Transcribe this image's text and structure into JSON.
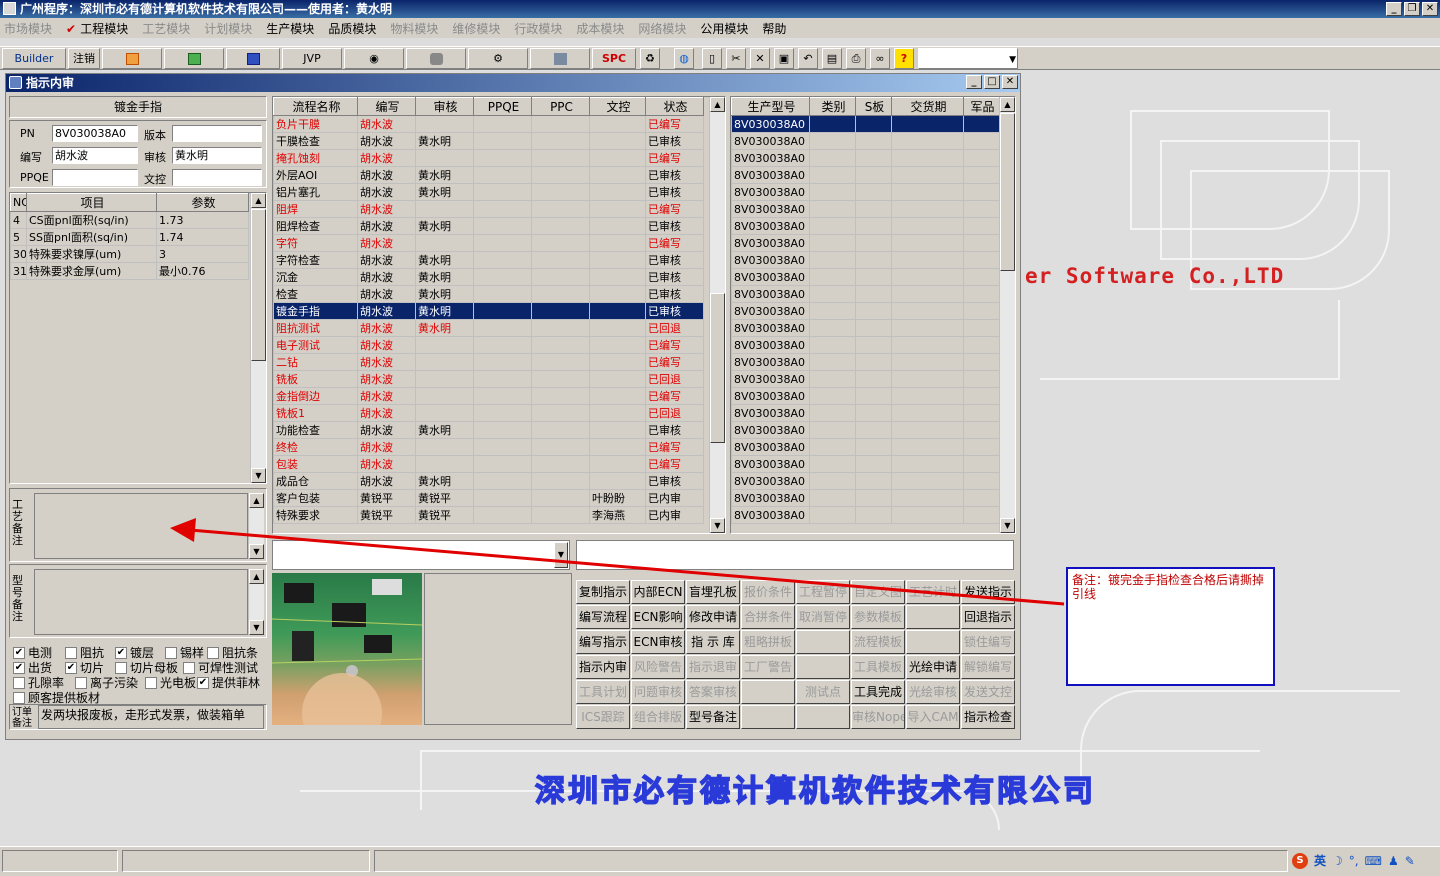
{
  "app": {
    "title": "广州程序：深圳市必有德计算机软件技术有限公司——使用者：黄水明"
  },
  "menu": [
    {
      "label": "市场模块",
      "disabled": true
    },
    {
      "label": "工程模块",
      "disabled": false,
      "checked": true
    },
    {
      "label": "工艺模块",
      "disabled": true
    },
    {
      "label": "计划模块",
      "disabled": true
    },
    {
      "label": "生产模块",
      "disabled": false
    },
    {
      "label": "品质模块",
      "disabled": false
    },
    {
      "label": "物料模块",
      "disabled": true
    },
    {
      "label": "维修模块",
      "disabled": true
    },
    {
      "label": "行政模块",
      "disabled": true
    },
    {
      "label": "成本模块",
      "disabled": true
    },
    {
      "label": "网络模块",
      "disabled": true
    },
    {
      "label": "公用模块",
      "disabled": false
    },
    {
      "label": "帮助",
      "disabled": false
    }
  ],
  "toolbar": {
    "builder": "Builder",
    "logout": "注销",
    "jvp": "JVP",
    "spc": "SPC",
    "help": "?"
  },
  "background": {
    "company_en": "er Software Co.,LTD",
    "company_cn": "深圳市必有德计算机软件技术有限公司"
  },
  "window": {
    "title": "指示内审"
  },
  "header": {
    "name": "镀金手指",
    "pn_label": "PN",
    "pn": "8V030038A0",
    "version_label": "版本",
    "version": "",
    "editor_label": "编写",
    "editor": "胡水波",
    "reviewer_label": "审核",
    "reviewer": "黄水明",
    "ppqe_label": "PPQE",
    "ppqe": "",
    "doc_label": "文控",
    "doc": ""
  },
  "params": {
    "columns": [
      "NO",
      "项目",
      "参数"
    ],
    "rows": [
      [
        "4",
        "CS面pnl面积(sq/in)",
        "1.73"
      ],
      [
        "5",
        "SS面pnl面积(sq/in)",
        "1.74"
      ],
      [
        "30",
        "特殊要求镍厚(um)",
        "3"
      ],
      [
        "31",
        "特殊要求金厚(um)",
        "最小0.76"
      ]
    ]
  },
  "process": {
    "columns": [
      "流程名称",
      "编写",
      "审核",
      "PPQE",
      "PPC",
      "文控",
      "状态"
    ],
    "rows": [
      {
        "c": [
          "负片干膜",
          "胡水波",
          "",
          "",
          "",
          "",
          "已编写"
        ],
        "red": true
      },
      {
        "c": [
          "干膜检查",
          "胡水波",
          "黄水明",
          "",
          "",
          "",
          "已审核"
        ],
        "red": false
      },
      {
        "c": [
          "掩孔蚀刻",
          "胡水波",
          "",
          "",
          "",
          "",
          "已编写"
        ],
        "red": true
      },
      {
        "c": [
          "外层AOI",
          "胡水波",
          "黄水明",
          "",
          "",
          "",
          "已审核"
        ],
        "red": false
      },
      {
        "c": [
          "铝片塞孔",
          "胡水波",
          "黄水明",
          "",
          "",
          "",
          "已审核"
        ],
        "red": false
      },
      {
        "c": [
          "阻焊",
          "胡水波",
          "",
          "",
          "",
          "",
          "已编写"
        ],
        "red": true
      },
      {
        "c": [
          "阻焊检查",
          "胡水波",
          "黄水明",
          "",
          "",
          "",
          "已审核"
        ],
        "red": false
      },
      {
        "c": [
          "字符",
          "胡水波",
          "",
          "",
          "",
          "",
          "已编写"
        ],
        "red": true
      },
      {
        "c": [
          "字符检查",
          "胡水波",
          "黄水明",
          "",
          "",
          "",
          "已审核"
        ],
        "red": false
      },
      {
        "c": [
          "沉金",
          "胡水波",
          "黄水明",
          "",
          "",
          "",
          "已审核"
        ],
        "red": false
      },
      {
        "c": [
          "检查",
          "胡水波",
          "黄水明",
          "",
          "",
          "",
          "已审核"
        ],
        "red": false
      },
      {
        "c": [
          "镀金手指",
          "胡水波",
          "黄水明",
          "",
          "",
          "",
          "已审核"
        ],
        "red": false,
        "selected": true
      },
      {
        "c": [
          "阻抗测试",
          "胡水波",
          "黄水明",
          "",
          "",
          "",
          "已回退"
        ],
        "red": true
      },
      {
        "c": [
          "电子测试",
          "胡水波",
          "",
          "",
          "",
          "",
          "已编写"
        ],
        "red": true
      },
      {
        "c": [
          "二钻",
          "胡水波",
          "",
          "",
          "",
          "",
          "已编写"
        ],
        "red": true
      },
      {
        "c": [
          "铣板",
          "胡水波",
          "",
          "",
          "",
          "",
          "已回退"
        ],
        "red": true
      },
      {
        "c": [
          "金指倒边",
          "胡水波",
          "",
          "",
          "",
          "",
          "已编写"
        ],
        "red": true
      },
      {
        "c": [
          "铣板1",
          "胡水波",
          "",
          "",
          "",
          "",
          "已回退"
        ],
        "red": true
      },
      {
        "c": [
          "功能检查",
          "胡水波",
          "黄水明",
          "",
          "",
          "",
          "已审核"
        ],
        "red": false
      },
      {
        "c": [
          "终检",
          "胡水波",
          "",
          "",
          "",
          "",
          "已编写"
        ],
        "red": true
      },
      {
        "c": [
          "包装",
          "胡水波",
          "",
          "",
          "",
          "",
          "已编写"
        ],
        "red": true
      },
      {
        "c": [
          "成品仓",
          "胡水波",
          "黄水明",
          "",
          "",
          "",
          "已审核"
        ],
        "red": false
      },
      {
        "c": [
          "客户包装",
          "黄锐平",
          "黄锐平",
          "",
          "",
          "叶盼盼",
          "已内审"
        ],
        "red": false
      },
      {
        "c": [
          "特殊要求",
          "黄锐平",
          "黄锐平",
          "",
          "",
          "李海燕",
          "已内审"
        ],
        "red": false
      }
    ]
  },
  "models": {
    "columns": [
      "生产型号",
      "类别",
      "S板",
      "交货期",
      "军品"
    ],
    "value": "8V030038A0",
    "count": 24
  },
  "side_labels": {
    "craft_note": "工艺备注",
    "model_note": "型号备注",
    "order_note": "订单备注"
  },
  "checkboxes": [
    {
      "label": "电测",
      "checked": true
    },
    {
      "label": "阻抗",
      "checked": false
    },
    {
      "label": "镀层",
      "checked": true
    },
    {
      "label": "锡样",
      "checked": false
    },
    {
      "label": "阻抗条",
      "checked": false
    },
    {
      "label": "出货",
      "checked": true
    },
    {
      "label": "切片",
      "checked": true
    },
    {
      "label": "切片母板",
      "checked": false
    },
    {
      "label": "可焊性测试",
      "checked": false
    },
    {
      "label": "孔隙率",
      "checked": false
    },
    {
      "label": "离子污染",
      "checked": false
    },
    {
      "label": "光电板",
      "checked": false
    },
    {
      "label": "提供菲林",
      "checked": true
    },
    {
      "label": "顾客提供板材",
      "checked": false
    }
  ],
  "order_note": "发两块报废板，走形式发票，做装箱单",
  "buttons": [
    [
      {
        "t": "复制指示",
        "d": false
      },
      {
        "t": "内部ECN",
        "d": false
      },
      {
        "t": "盲埋孔板",
        "d": false
      },
      {
        "t": "报价条件",
        "d": true
      },
      {
        "t": "工程暂停",
        "d": true
      },
      {
        "t": "自定义图",
        "d": true
      },
      {
        "t": "工艺计时",
        "d": true
      },
      {
        "t": "发送指示",
        "d": false
      }
    ],
    [
      {
        "t": "编写流程",
        "d": false
      },
      {
        "t": "ECN影响",
        "d": false
      },
      {
        "t": "修改申请",
        "d": false
      },
      {
        "t": "合拼条件",
        "d": true
      },
      {
        "t": "取消暂停",
        "d": true
      },
      {
        "t": "参数模板",
        "d": true
      },
      {
        "t": "",
        "d": true
      },
      {
        "t": "回退指示",
        "d": false
      }
    ],
    [
      {
        "t": "编写指示",
        "d": false
      },
      {
        "t": "ECN审核",
        "d": false
      },
      {
        "t": "指 示 库",
        "d": false
      },
      {
        "t": "粗略拼板",
        "d": true
      },
      {
        "t": "",
        "d": true
      },
      {
        "t": "流程模板",
        "d": true
      },
      {
        "t": "",
        "d": true
      },
      {
        "t": "锁住编写",
        "d": true
      }
    ],
    [
      {
        "t": "指示内审",
        "d": false
      },
      {
        "t": "风险警告",
        "d": true
      },
      {
        "t": "指示退审",
        "d": true
      },
      {
        "t": "工厂警告",
        "d": true
      },
      {
        "t": "",
        "d": true
      },
      {
        "t": "工具模板",
        "d": true
      },
      {
        "t": "光绘申请",
        "d": false
      },
      {
        "t": "解锁编写",
        "d": true
      }
    ],
    [
      {
        "t": "工具计划",
        "d": true
      },
      {
        "t": "问题审核",
        "d": true
      },
      {
        "t": "答案审核",
        "d": true
      },
      {
        "t": "",
        "d": true
      },
      {
        "t": "测试点",
        "d": true
      },
      {
        "t": "工具完成",
        "d": false
      },
      {
        "t": "光绘审核",
        "d": true
      },
      {
        "t": "发送文控",
        "d": true
      }
    ],
    [
      {
        "t": "ICS跟踪",
        "d": true
      },
      {
        "t": "组合排版",
        "d": true
      },
      {
        "t": "型号备注",
        "d": false
      },
      {
        "t": "",
        "d": true
      },
      {
        "t": "",
        "d": true
      },
      {
        "t": "审核Nope",
        "d": true
      },
      {
        "t": "导入CAM",
        "d": true
      },
      {
        "t": "指示检查",
        "d": false
      }
    ]
  ],
  "annotation": {
    "text": "备注：镀完金手指检查合格后请撕掉引线"
  },
  "tray": {
    "ime": "英"
  }
}
